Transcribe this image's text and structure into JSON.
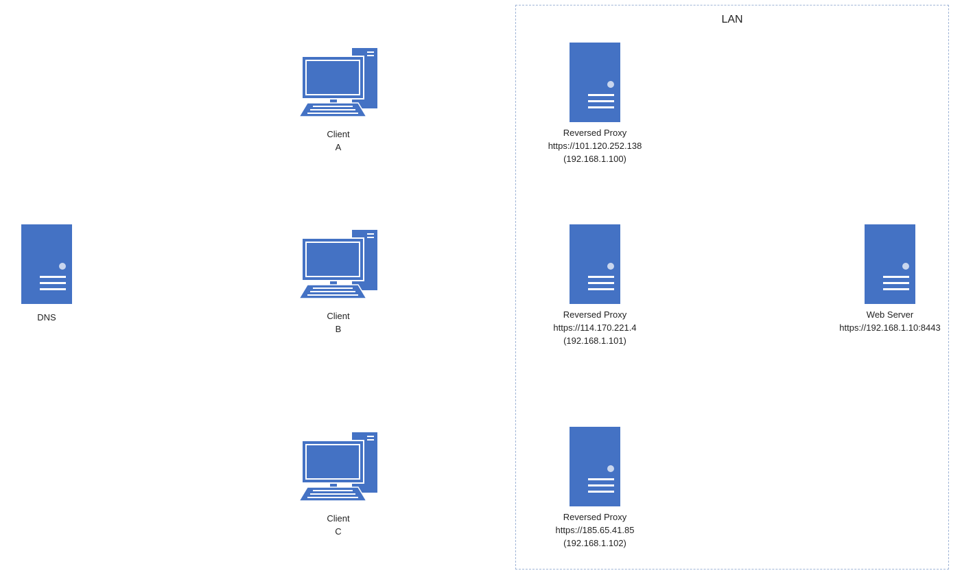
{
  "lan": {
    "title": "LAN"
  },
  "dns": {
    "name": "DNS"
  },
  "clients": [
    {
      "line1": "Client",
      "line2": "A"
    },
    {
      "line1": "Client",
      "line2": "B"
    },
    {
      "line1": "Client",
      "line2": "C"
    }
  ],
  "proxies": [
    {
      "name": "Reversed Proxy",
      "public": "https://101.120.252.138",
      "private": "(192.168.1.100)"
    },
    {
      "name": "Reversed Proxy",
      "public": "https://114.170.221.4",
      "private": "(192.168.1.101)"
    },
    {
      "name": "Reversed Proxy",
      "public": "https://185.65.41.85",
      "private": "(192.168.1.102)"
    }
  ],
  "webserver": {
    "name": "Web Server",
    "url": "https://192.168.1.10:8443"
  },
  "colors": {
    "device_fill": "#4472c4",
    "device_highlight": "#ffffff",
    "lan_border": "#9fb4d6"
  },
  "icons": {
    "server": "server-icon",
    "client": "desktop-computer-icon"
  }
}
